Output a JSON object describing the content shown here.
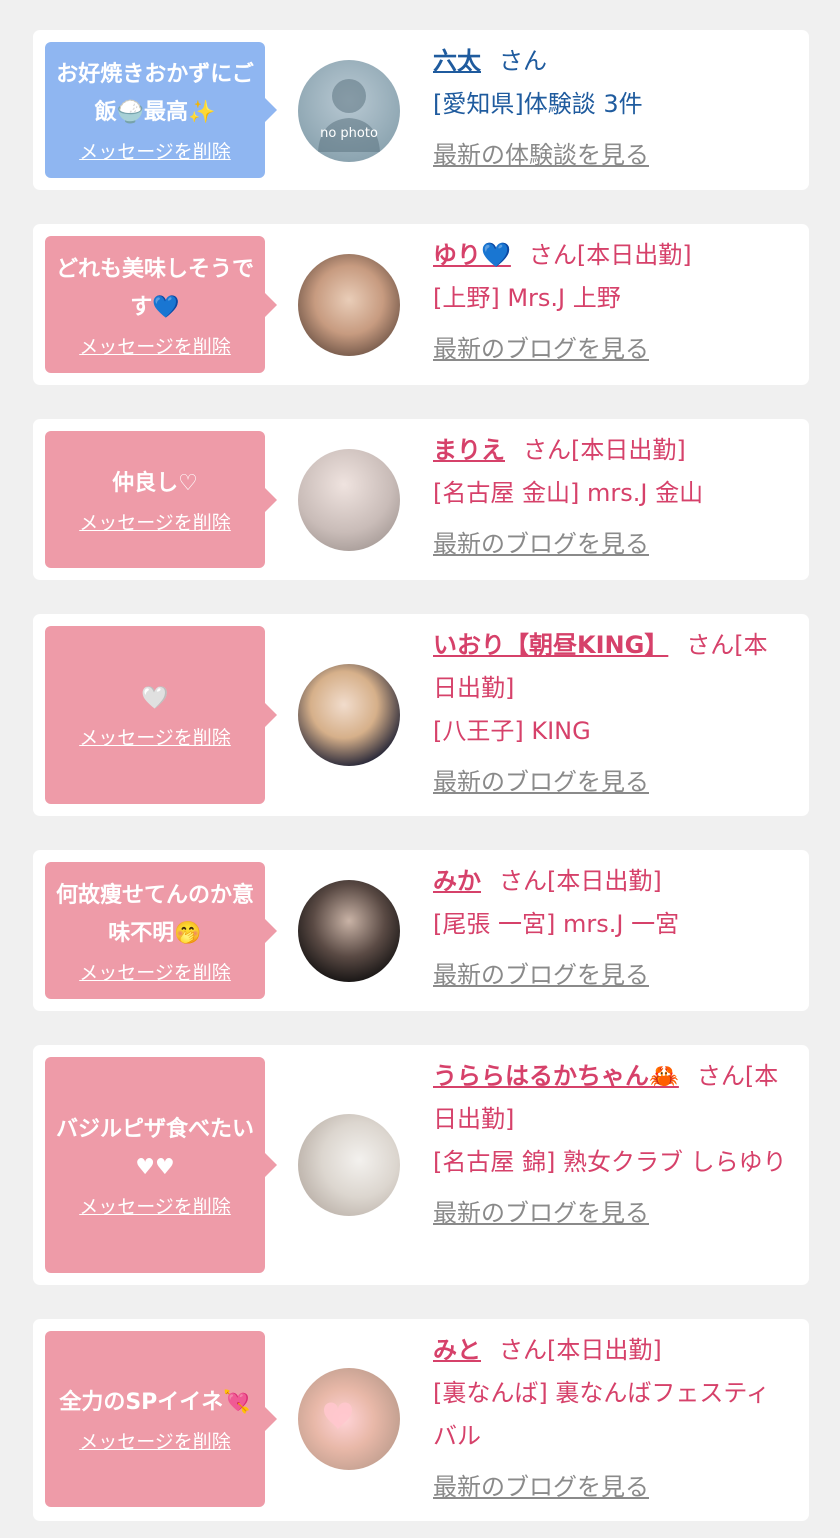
{
  "entries": [
    {
      "message": "お好焼きおかずにご飯🍚最高✨",
      "delete_label": "メッセージを削除",
      "name": "六太",
      "suffix": "さん",
      "shop": "[愛知県]体験談 3件",
      "more_label": "最新の体験談を見る",
      "avatar_text": "no photo"
    },
    {
      "message": "どれも美味しそうです💙",
      "delete_label": "メッセージを削除",
      "name": "ゆり💙",
      "suffix": "さん[本日出勤]",
      "shop": "[上野] Mrs.J 上野",
      "more_label": "最新のブログを見る"
    },
    {
      "message": "仲良し♡",
      "delete_label": "メッセージを削除",
      "name": "まりえ",
      "suffix": "さん[本日出勤]",
      "shop": "[名古屋 金山] mrs.J 金山",
      "more_label": "最新のブログを見る"
    },
    {
      "message": "🤍",
      "delete_label": "メッセージを削除",
      "name": "いおり【朝昼KING】",
      "suffix": "さん[本日出勤]",
      "shop": "[八王子] KING",
      "more_label": "最新のブログを見る"
    },
    {
      "message": "何故痩せてんのか意味不明🤭",
      "delete_label": "メッセージを削除",
      "name": "みか",
      "suffix": "さん[本日出勤]",
      "shop": "[尾張 一宮] mrs.J 一宮",
      "more_label": "最新のブログを見る"
    },
    {
      "message": "バジルピザ食べたい♥♥",
      "delete_label": "メッセージを削除",
      "name": "うららはるかちゃん🦀",
      "suffix": "さん[本日出勤]",
      "shop": "[名古屋 錦] 熟女クラブ しらゆり",
      "more_label": "最新のブログを見る"
    },
    {
      "message": "全力のSPイイネ💘",
      "delete_label": "メッセージを削除",
      "name": "みと",
      "suffix": "さん[本日出勤]",
      "shop": "[裏なんば] 裏なんばフェスティバル",
      "more_label": "最新のブログを見る"
    }
  ],
  "colors": {
    "background": "#f0f0f0",
    "card": "#ffffff",
    "bubble_blue": "#8fb6f1",
    "bubble_pink": "#ee9ba8",
    "text_blue": "#1f5b9e",
    "text_pink": "#d6416a",
    "link_gray": "#8a8a8a"
  }
}
